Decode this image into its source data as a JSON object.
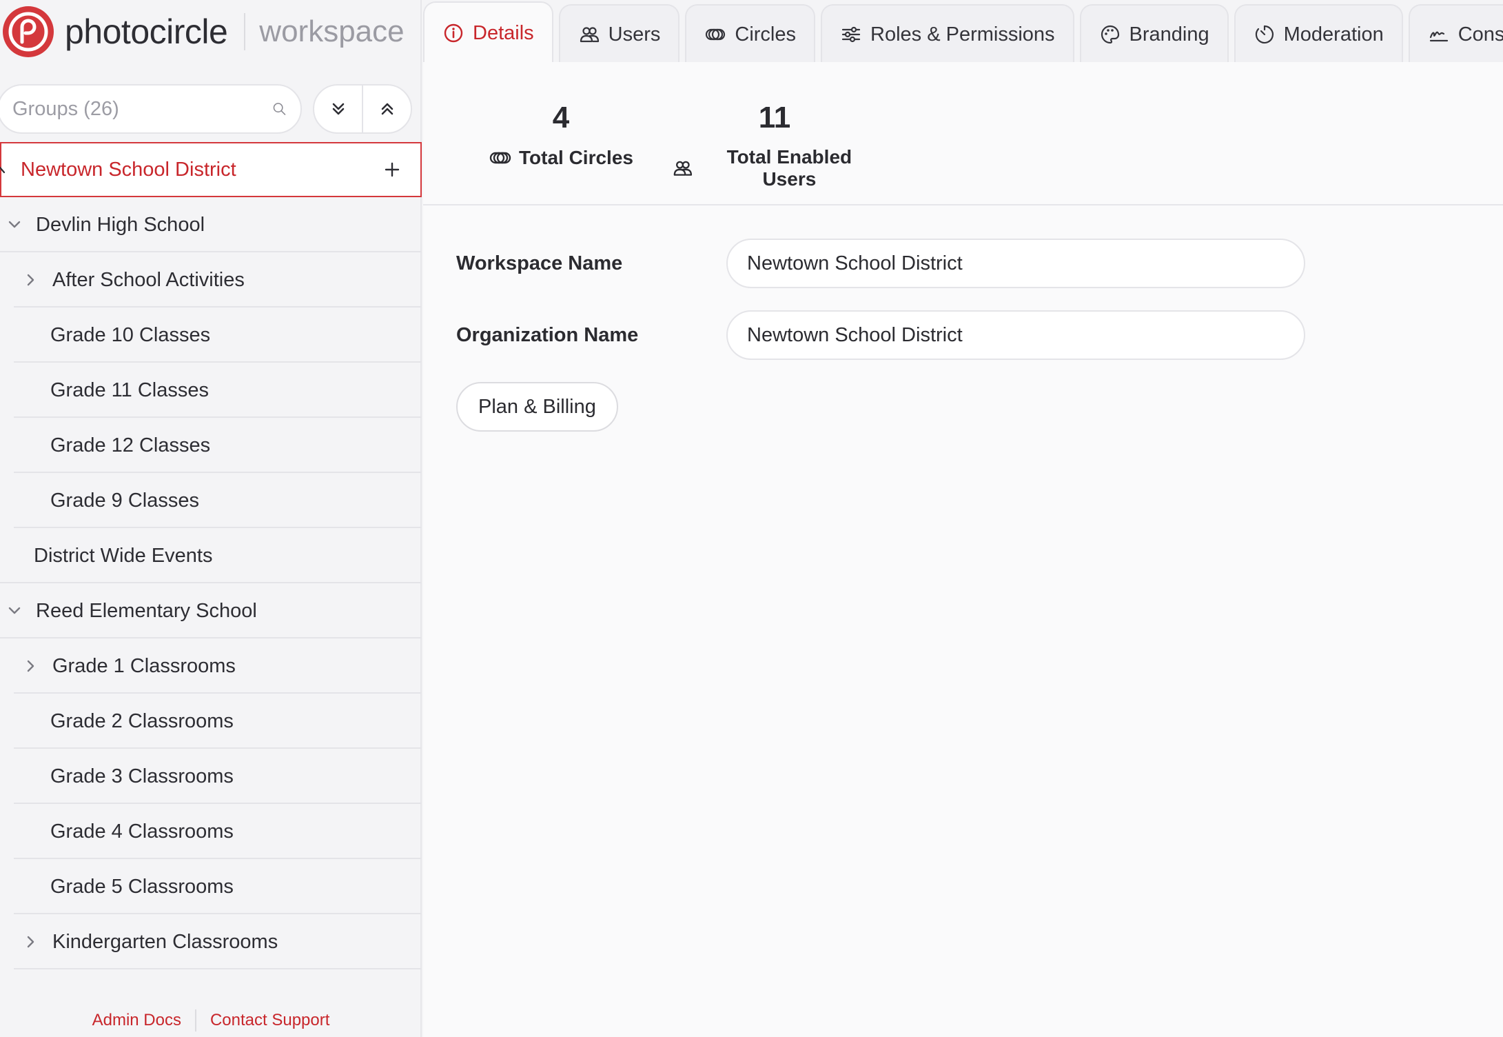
{
  "brand": {
    "name": "photocircle",
    "sub": "workspace",
    "accent": "#d4383c"
  },
  "sidebar": {
    "search_placeholder": "Groups (26)",
    "root": "Newtown School District",
    "items": [
      {
        "label": "Devlin High School"
      },
      {
        "label": "After School Activities"
      },
      {
        "label": "Grade 10 Classes"
      },
      {
        "label": "Grade 11 Classes"
      },
      {
        "label": "Grade 12 Classes"
      },
      {
        "label": "Grade 9 Classes"
      },
      {
        "label": "District Wide Events"
      },
      {
        "label": "Reed Elementary School"
      },
      {
        "label": "Grade 1 Classrooms"
      },
      {
        "label": "Grade 2 Classrooms"
      },
      {
        "label": "Grade 3 Classrooms"
      },
      {
        "label": "Grade 4 Classrooms"
      },
      {
        "label": "Grade 5 Classrooms"
      },
      {
        "label": "Kindergarten Classrooms"
      }
    ],
    "footer": {
      "docs": "Admin Docs",
      "support": "Contact Support"
    }
  },
  "tabs": [
    {
      "label": "Details",
      "icon": "info-icon"
    },
    {
      "label": "Users",
      "icon": "users-icon"
    },
    {
      "label": "Circles",
      "icon": "circles-icon"
    },
    {
      "label": "Roles & Permissions",
      "icon": "sliders-icon"
    },
    {
      "label": "Branding",
      "icon": "palette-icon"
    },
    {
      "label": "Moderation",
      "icon": "timer-icon"
    },
    {
      "label": "Consent",
      "icon": "signature-icon"
    }
  ],
  "stats": {
    "circles": {
      "value": "4",
      "label": "Total Circles"
    },
    "users": {
      "value": "11",
      "label": "Total Enabled Users"
    }
  },
  "form": {
    "workspace_label": "Workspace Name",
    "workspace_value": "Newtown School District",
    "org_label": "Organization Name",
    "org_value": "Newtown School District",
    "plan_button": "Plan & Billing"
  }
}
